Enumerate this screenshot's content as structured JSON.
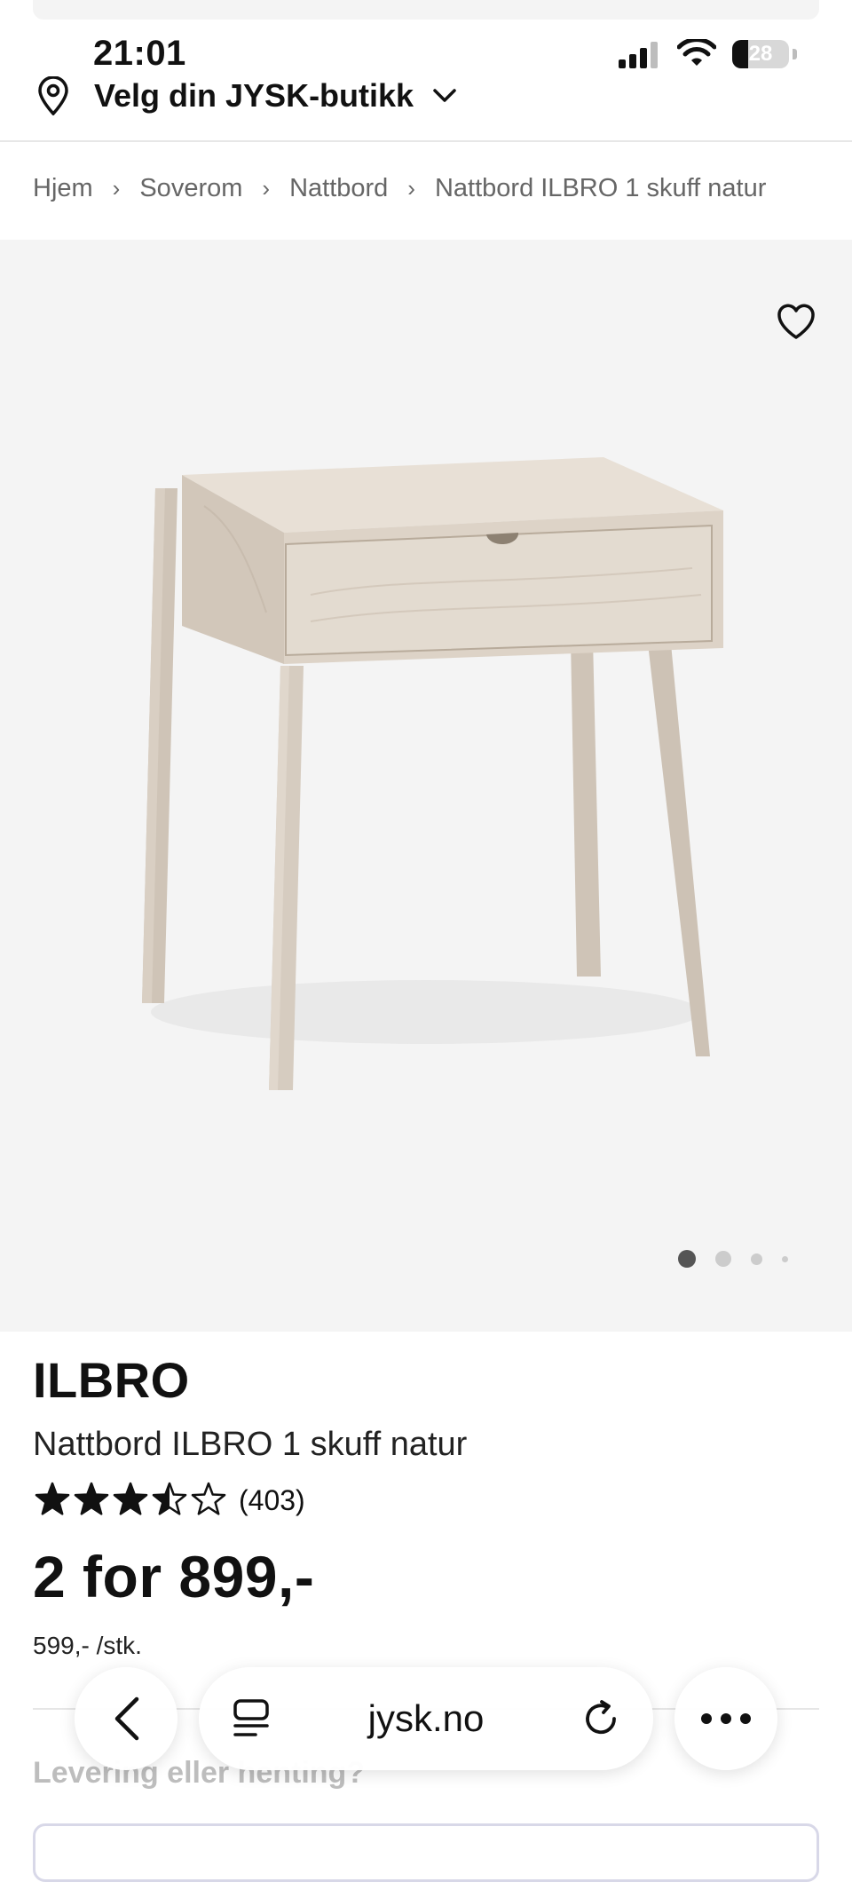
{
  "status_bar": {
    "time": "21:01",
    "battery": "28",
    "battery_level": 0.28
  },
  "store_selector": {
    "label": "Velg din JYSK-butikk",
    "icon": "location-pin-icon"
  },
  "breadcrumb": [
    {
      "label": "Hjem"
    },
    {
      "label": "Soverom"
    },
    {
      "label": "Nattbord"
    },
    {
      "label": "Nattbord ILBRO 1 skuff natur"
    }
  ],
  "gallery": {
    "image_count": 4,
    "active_index": 0
  },
  "product": {
    "brand": "ILBRO",
    "name": "Nattbord ILBRO 1 skuff natur",
    "rating": 3.5,
    "rating_max": 5,
    "review_count": "(403)",
    "price": "2 for 899,-",
    "unit_price": "599,- /stk."
  },
  "delivery": {
    "heading": "Levering eller henting?"
  },
  "browser_toolbar": {
    "url": "jysk.no"
  },
  "colors": {
    "background": "#ffffff",
    "gallery_bg": "#f4f4f4",
    "text": "#111111",
    "muted": "#666666",
    "wood": "#d9cfc3"
  }
}
